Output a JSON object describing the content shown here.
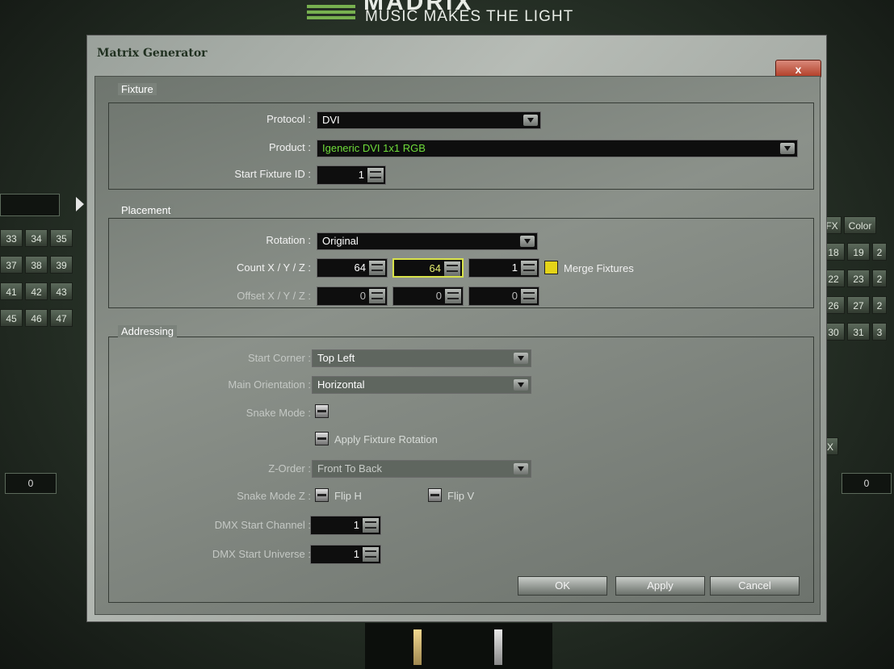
{
  "banner": {
    "brand": "MADRIX",
    "tagline": "MUSIC MAKES THE LIGHT"
  },
  "background": {
    "left_grid": [
      "33",
      "34",
      "35",
      "37",
      "38",
      "39",
      "41",
      "42",
      "43",
      "45",
      "46",
      "47"
    ],
    "right_grid": [
      "FX",
      "Color",
      "18",
      "19",
      "2",
      "22",
      "23",
      "2",
      "26",
      "27",
      "2",
      "30",
      "31",
      "3"
    ],
    "left_value": "0",
    "right_value": "0",
    "side_x": "X"
  },
  "dialog": {
    "title": "Matrix Generator",
    "close_label": "x",
    "fixture": {
      "group_title": "Fixture",
      "protocol_label": "Protocol :",
      "protocol_value": "DVI",
      "product_label": "Product :",
      "product_value": "Igeneric DVI 1x1 RGB",
      "start_id_label": "Start Fixture ID :",
      "start_id_value": "1"
    },
    "placement": {
      "group_title": "Placement",
      "rotation_label": "Rotation :",
      "rotation_value": "Original",
      "count_label": "Count X / Y / Z :",
      "count_x": "64",
      "count_y": "64",
      "count_z": "1",
      "merge_label": "Merge Fixtures",
      "offset_label": "Offset X / Y / Z :",
      "offset_x": "0",
      "offset_y": "0",
      "offset_z": "0"
    },
    "addressing": {
      "group_title": "Addressing",
      "start_corner_label": "Start Corner :",
      "start_corner_value": "Top Left",
      "orientation_label": "Main Orientation :",
      "orientation_value": "Horizontal",
      "snake_label": "Snake Mode :",
      "apply_rotation_label": "Apply Fixture Rotation",
      "zorder_label": "Z-Order :",
      "zorder_value": "Front To Back",
      "snake_z_label": "Snake Mode Z :",
      "flip_h_label": "Flip H",
      "flip_v_label": "Flip V",
      "dmx_channel_label": "DMX Start Channel :",
      "dmx_channel_value": "1",
      "dmx_universe_label": "DMX Start Universe :",
      "dmx_universe_value": "1"
    },
    "buttons": {
      "ok": "OK",
      "apply": "Apply",
      "cancel": "Cancel"
    }
  }
}
